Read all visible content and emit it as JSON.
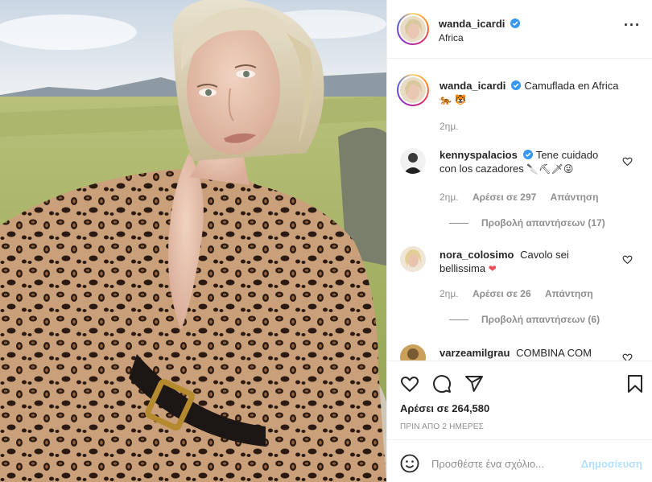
{
  "post": {
    "author": "wanda_icardi",
    "location": "Africa",
    "caption_text": "Camuflada en Africa",
    "caption_emoji": "🐅 🐯",
    "caption_time": "2ημ."
  },
  "comments": [
    {
      "username": "kennyspalacios",
      "verified": true,
      "text_line1": "Tene cuidado",
      "text_line2": "con los cazadores",
      "text_emoji": "🔪⛏🗡😜",
      "time": "2ημ.",
      "likes": "Αρέσει σε 297",
      "reply": "Απάντηση",
      "view_replies": "Προβολή απαντήσεων (17)"
    },
    {
      "username": "nora_colosimo",
      "verified": false,
      "text_line1": "Cavolo sei",
      "text_line2": "bellissima",
      "text_emoji": "❤",
      "time": "2ημ.",
      "likes": "Αρέσει σε 26",
      "reply": "Απάντηση",
      "view_replies": "Προβολή απαντήσεων (6)"
    },
    {
      "username": "varzeamilgrau",
      "verified": false,
      "text_line1": "COMBINA COM",
      "text_line2": "",
      "text_emoji": ""
    }
  ],
  "actions": {
    "likes_text": "Αρέσει σε 264,580",
    "time_text": "ΠΡΙΝ ΑΠΟ 2 ΗΜΕΡΕΣ",
    "icons": [
      "heart-icon",
      "comment-icon",
      "share-icon",
      "bookmark-icon"
    ]
  },
  "add_comment": {
    "placeholder": "Προσθέστε ένα σχόλιο...",
    "post_label": "Δημοσίευση"
  },
  "colors": {
    "verified": "#3897f0",
    "link_disabled": "#b2dffc",
    "muted": "#8e8e8e",
    "heart_red": "#ed4956"
  }
}
